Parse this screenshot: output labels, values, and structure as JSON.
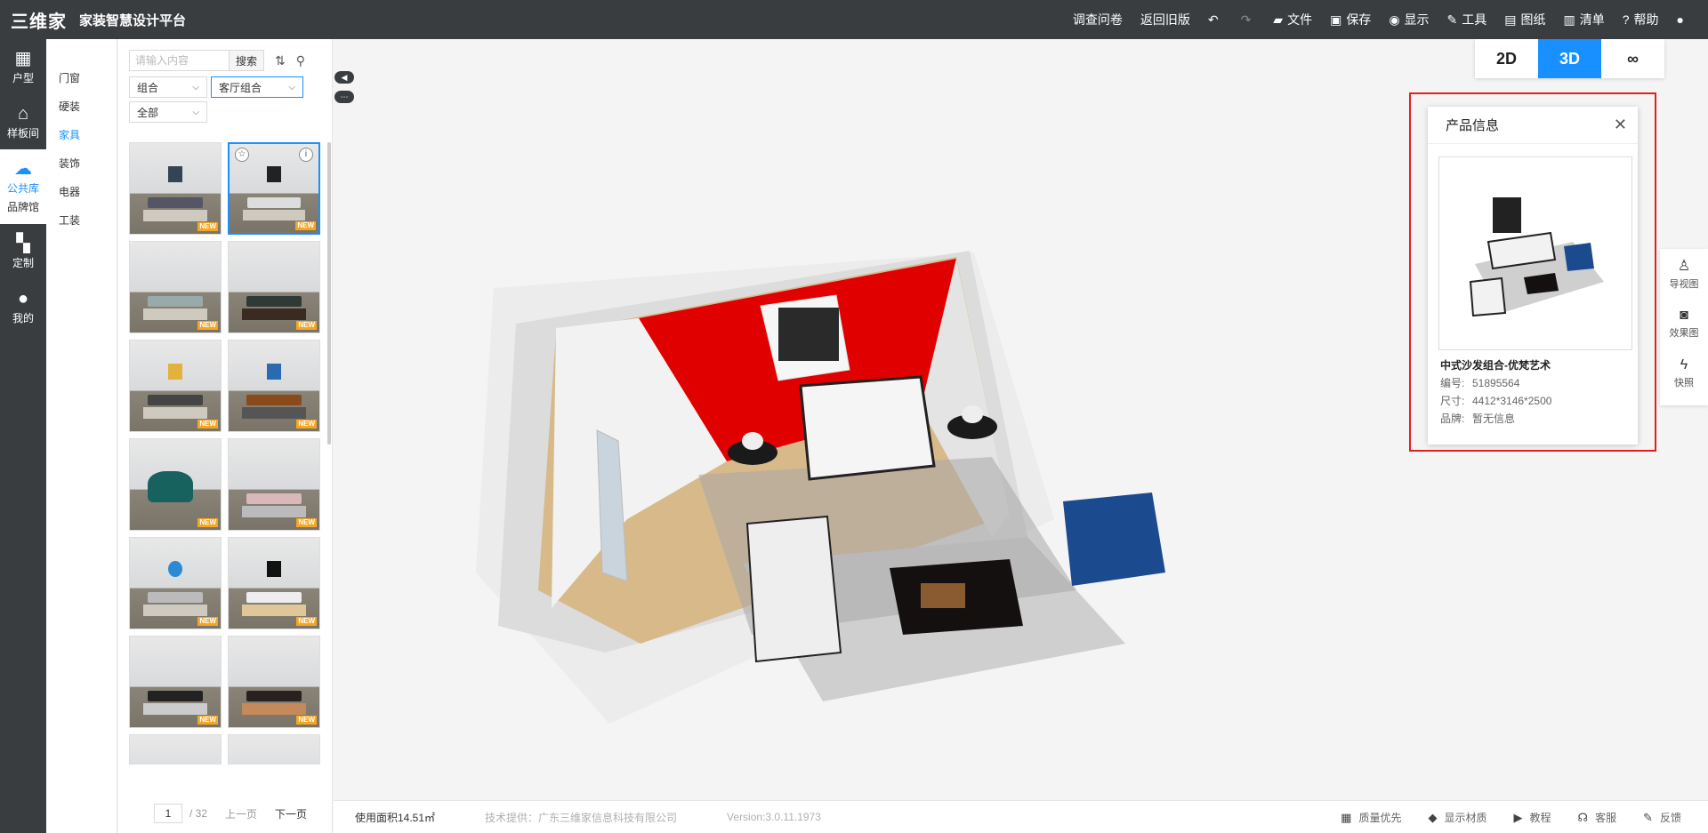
{
  "app": {
    "logo": "三维家",
    "title": "家装智慧设计平台"
  },
  "toolbar": {
    "survey": "调查问卷",
    "back_old": "返回旧版",
    "undo_icon": "↶",
    "redo_icon": "↷",
    "file": "文件",
    "save": "保存",
    "display": "显示",
    "tools": "工具",
    "drawings": "图纸",
    "list": "清单",
    "help": "帮助"
  },
  "rail": {
    "floorplan": "户型",
    "showroom": "样板间",
    "public_lib": "公共库",
    "brand_hall": "品牌馆",
    "custom": "定制",
    "mine": "我的"
  },
  "categories": [
    "门窗",
    "硬装",
    "家具",
    "装饰",
    "电器",
    "工装"
  ],
  "active_category": "家具",
  "search": {
    "placeholder": "请输入内容",
    "button": "搜索"
  },
  "filters": {
    "type": "组合",
    "subtype": "客厅组合",
    "scope": "全部"
  },
  "badge_new": "NEW",
  "pager": {
    "current": "1",
    "total": "/ 32",
    "prev": "上一页",
    "next": "下一页"
  },
  "view_modes": {
    "two_d": "2D",
    "three_d": "3D",
    "vr": "∞"
  },
  "product_info": {
    "title": "产品信息",
    "name": "中式沙发组合-优梵艺术",
    "code_label": "编号:",
    "code": "51895564",
    "size_label": "尺寸:",
    "size": "4412*3146*2500",
    "brand_label": "品牌:",
    "brand": "暂无信息"
  },
  "right_tools": {
    "guide": "导视图",
    "render": "效果图",
    "snapshot": "快照"
  },
  "status": {
    "area": "使用面积14.51㎡",
    "tech": "技术提供：广东三维家信息科技有限公司",
    "version": "Version:3.0.11.1973",
    "quality": "质量优先",
    "material": "显示材质",
    "tutorial": "教程",
    "support": "客服",
    "feedback": "反馈"
  },
  "colors": {
    "accent": "#1890ff",
    "topbar": "#3a3d40",
    "highlight": "#e02020",
    "wall_red": "#e00000"
  }
}
